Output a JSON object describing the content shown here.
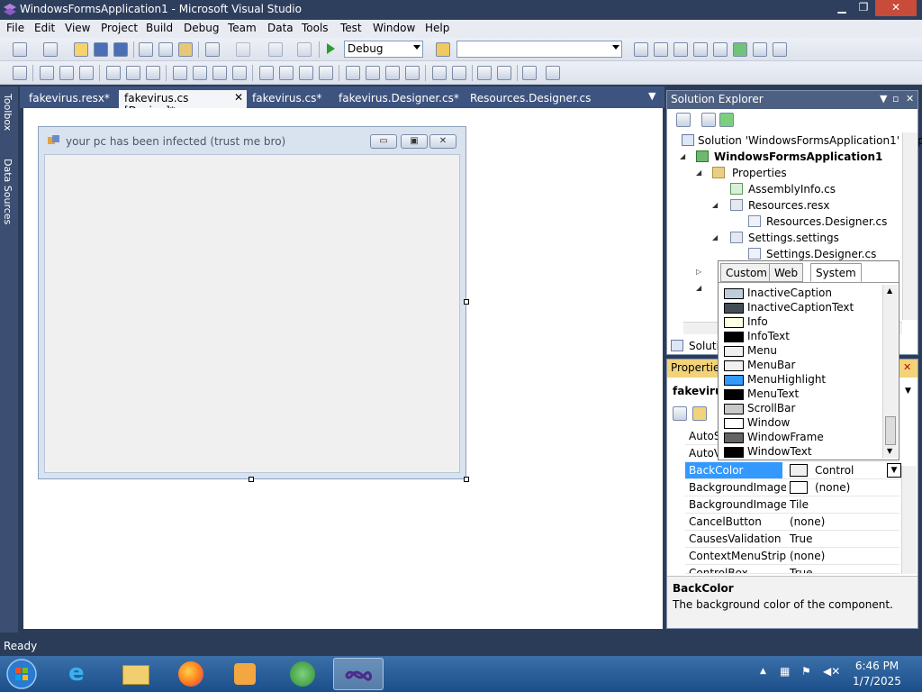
{
  "window": {
    "title": "WindowsFormsApplication1 - Microsoft Visual Studio"
  },
  "menu": [
    "File",
    "Edit",
    "View",
    "Project",
    "Build",
    "Debug",
    "Team",
    "Data",
    "Tools",
    "Test",
    "Window",
    "Help"
  ],
  "toolbar": {
    "config_value": "Debug",
    "platform_value": ""
  },
  "left_strip": {
    "toolbox": "Toolbox",
    "data_sources": "Data Sources"
  },
  "doc_tabs": [
    {
      "label": "fakevirus.resx*",
      "active": false
    },
    {
      "label": "fakevirus.cs [Design]*",
      "active": true
    },
    {
      "label": "fakevirus.cs*",
      "active": false
    },
    {
      "label": "fakevirus.Designer.cs*",
      "active": false
    },
    {
      "label": "Resources.Designer.cs",
      "active": false
    }
  ],
  "form": {
    "caption": "your pc has been infected (trust me bro)"
  },
  "solution_explorer": {
    "title": "Solution Explorer",
    "solution": "Solution 'WindowsFormsApplication1' (1 p",
    "project": "WindowsFormsApplication1",
    "items": [
      "Properties",
      "AssemblyInfo.cs",
      "Resources.resx",
      "Resources.Designer.cs",
      "Settings.settings",
      "Settings.Designer.cs"
    ],
    "bottom_tab": "Soluti"
  },
  "properties": {
    "title": "Properties",
    "object": "fakevirus",
    "rows": [
      {
        "name": "AutoS",
        "value": ""
      },
      {
        "name": "AutoV",
        "value": ""
      },
      {
        "name": "BackColor",
        "value": "Control"
      },
      {
        "name": "BackgroundImage",
        "value": "(none)"
      },
      {
        "name": "BackgroundImageLa",
        "value": "Tile"
      },
      {
        "name": "CancelButton",
        "value": "(none)"
      },
      {
        "name": "CausesValidation",
        "value": "True"
      },
      {
        "name": "ContextMenuStrip",
        "value": "(none)"
      },
      {
        "name": "ControlBox",
        "value": "True"
      }
    ],
    "desc_title": "BackColor",
    "desc_text": "The background color of the component."
  },
  "color_dropdown": {
    "tabs": [
      "Custom",
      "Web",
      "System"
    ],
    "active_tab": "System",
    "items": [
      {
        "name": "InactiveCaption",
        "color": "#bfcddb"
      },
      {
        "name": "InactiveCaptionText",
        "color": "#434e54"
      },
      {
        "name": "Info",
        "color": "#ffffe1"
      },
      {
        "name": "InfoText",
        "color": "#000000"
      },
      {
        "name": "Menu",
        "color": "#f0f0f0"
      },
      {
        "name": "MenuBar",
        "color": "#f0f0f0"
      },
      {
        "name": "MenuHighlight",
        "color": "#3399ff"
      },
      {
        "name": "MenuText",
        "color": "#000000"
      },
      {
        "name": "ScrollBar",
        "color": "#c8c8c8"
      },
      {
        "name": "Window",
        "color": "#ffffff"
      },
      {
        "name": "WindowFrame",
        "color": "#646464"
      },
      {
        "name": "WindowText",
        "color": "#000000"
      }
    ]
  },
  "status": {
    "text": "Ready"
  },
  "taskbar": {
    "time": "6:46 PM",
    "date": "1/7/2025"
  }
}
